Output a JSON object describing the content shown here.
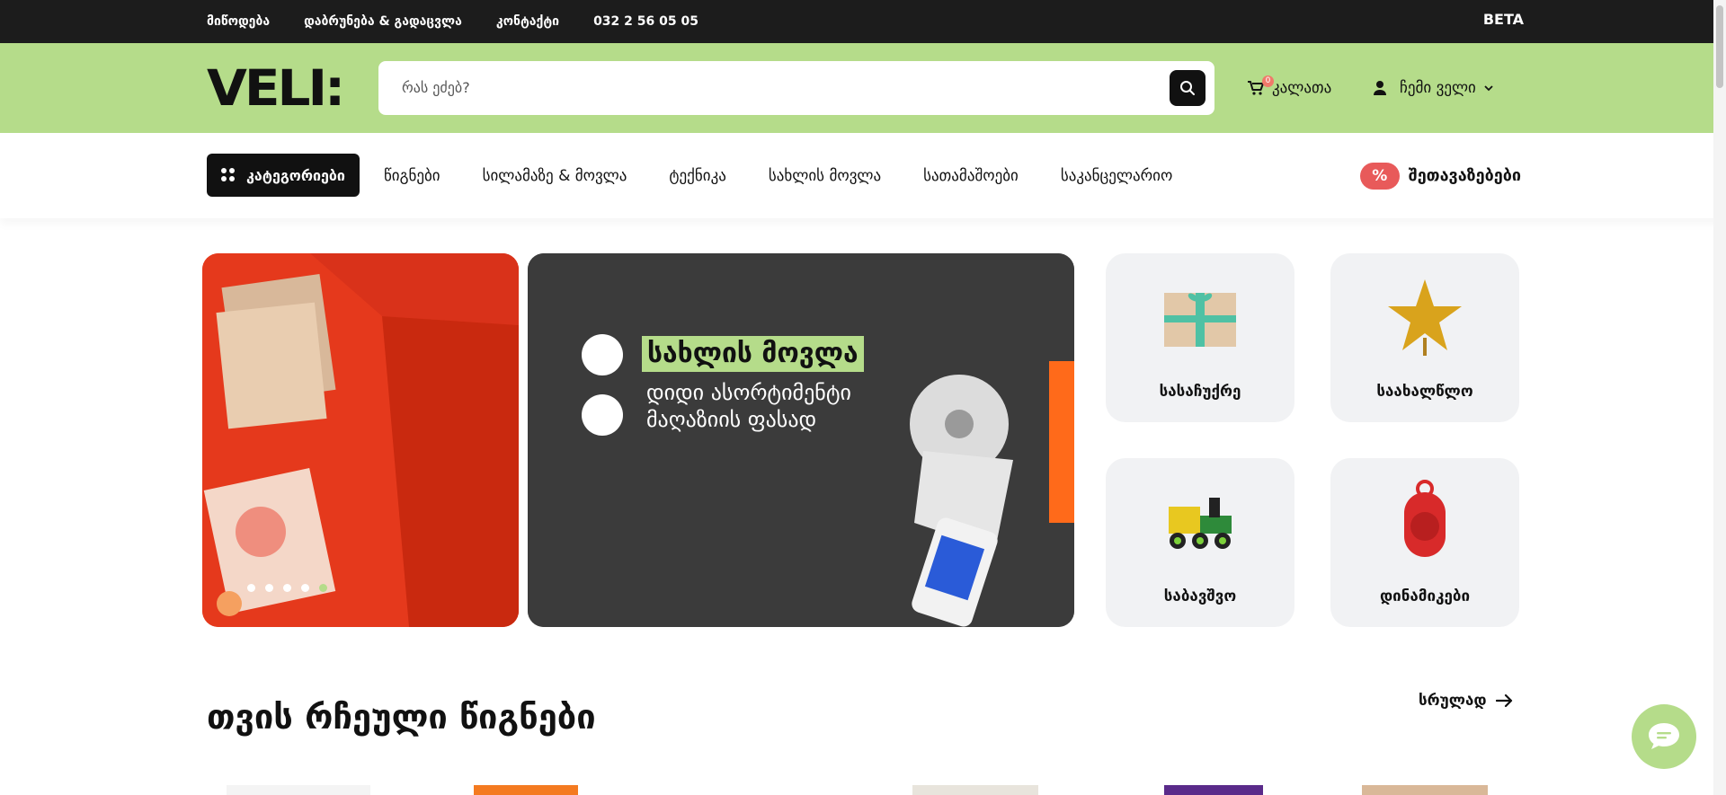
{
  "topbar": {
    "links": [
      "მიწოდება",
      "დაბრუნება & გადაცვლა",
      "კონტაქტი",
      "032 2 56 05 05"
    ],
    "beta": "BETA"
  },
  "header": {
    "logo": "VELI:",
    "search_placeholder": "რას ეძებ?",
    "cart_label": "კალათა",
    "cart_count": "0",
    "account_label": "ჩემი ველი"
  },
  "nav": {
    "categories_label": "კატეგორიები",
    "items": [
      "წიგნები",
      "სილამაზე & მოვლა",
      "ტექნიკა",
      "სახლის მოვლა",
      "სათამაშოები",
      "საკანცელარიო"
    ],
    "offers_badge": "%",
    "offers_label": "შეთავაზებები"
  },
  "banner": {
    "line1": "სახლის მოვლა",
    "line2": "დიდი ასორტიმენტი",
    "line3": "მაღაზიის ფასად",
    "dots_count": 5,
    "active_dot": 4
  },
  "tiles": [
    {
      "label": "სასაჩუქრე",
      "icon": "gift-box-icon"
    },
    {
      "label": "საახალწლო",
      "icon": "star-icon"
    },
    {
      "label": "საბავშვო",
      "icon": "toy-train-icon"
    },
    {
      "label": "დინამიკები",
      "icon": "speaker-icon"
    }
  ],
  "section": {
    "title": "თვის რჩეული წიგნები",
    "see_all": "სრულად"
  },
  "colors": {
    "accent": "#b5dc8a",
    "topbar": "#1c1c1c",
    "offers": "#e85a5a"
  }
}
